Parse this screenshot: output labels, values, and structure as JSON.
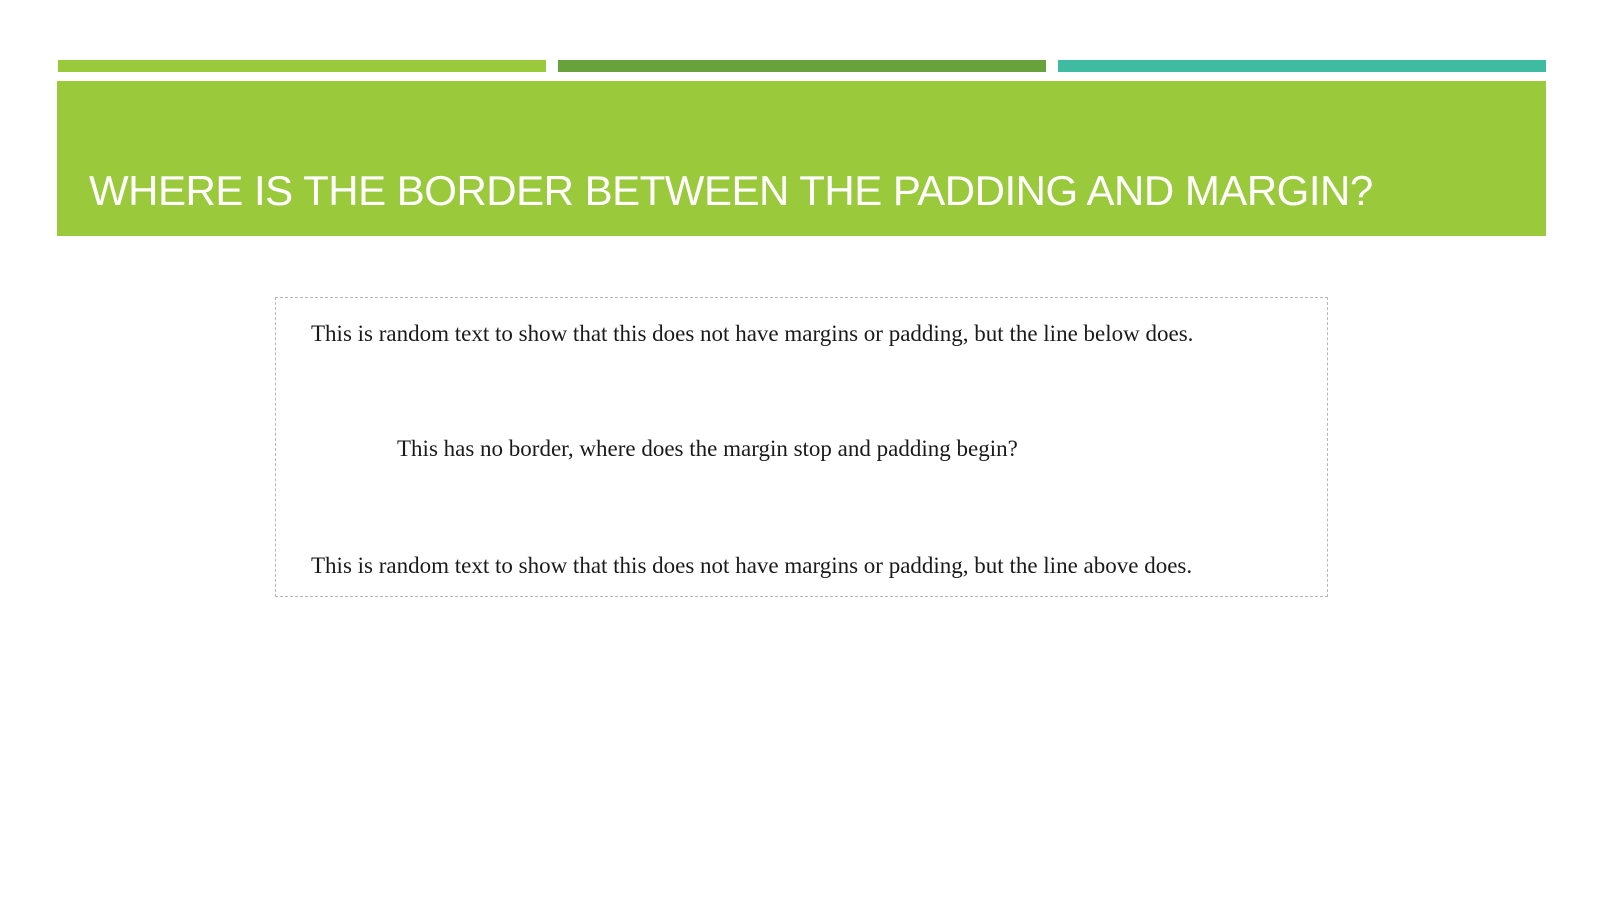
{
  "colors": {
    "bar_1": "#9aca3c",
    "bar_2": "#67a23c",
    "bar_3": "#3fbba2",
    "title_band": "#9aca3c",
    "title_text": "#ffffff",
    "box_border": "#b8b8b8"
  },
  "slide": {
    "title": "WHERE IS THE BORDER BETWEEN THE PADDING AND MARGIN?"
  },
  "demo": {
    "line_1": "This is random text to show that this does not have margins or padding, but the line below does.",
    "line_2": "This has no border, where does the margin stop and padding begin?",
    "line_3": "This is random text to show that this does not have margins or padding, but the line above does."
  }
}
